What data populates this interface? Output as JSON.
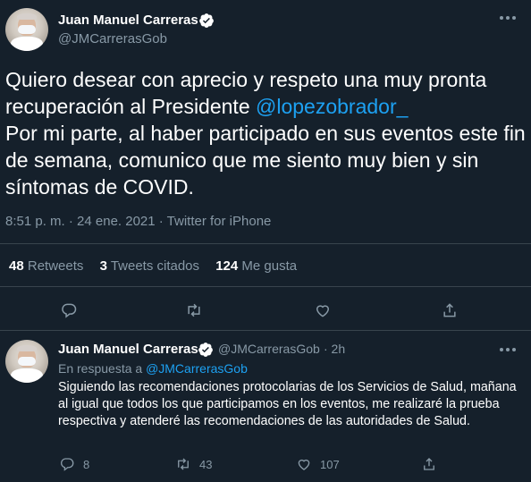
{
  "tweet": {
    "author_name": "Juan Manuel Carreras",
    "author_handle": "@JMCarrerasGob",
    "text_part1": "Quiero desear con aprecio y respeto una muy pronta recuperación al Presidente ",
    "mention": "@lopezobrador_",
    "text_part2": "Por mi parte, al haber participado en sus eventos este fin de semana, comunico que me siento muy bien y sin síntomas de COVID.",
    "meta": "8:51 p. m. · 24 ene. 2021 · Twitter for iPhone",
    "retweets_count": "48",
    "retweets_label": "Retweets",
    "quotes_count": "3",
    "quotes_label": "Tweets citados",
    "likes_count": "124",
    "likes_label": "Me gusta"
  },
  "reply": {
    "author_name": "Juan Manuel Carreras",
    "author_handle": "@JMCarrerasGob",
    "time": "· 2h",
    "in_reply_prefix": "En respuesta a ",
    "in_reply_handle": "@JMCarrerasGob",
    "text": "Siguiendo las recomendaciones protocolarias de los Servicios de Salud, mañana al igual que todos los que  participamos en los eventos, me realizaré la prueba respectiva y atenderé las recomendaciones de las autoridades de Salud.",
    "reply_count": "8",
    "retweet_count": "43",
    "like_count": "107"
  },
  "icons": {
    "verified": "verified-badge-icon",
    "more": "more-icon",
    "reply": "reply-icon",
    "retweet": "retweet-icon",
    "like": "heart-icon",
    "share": "share-icon"
  },
  "colors": {
    "background": "#15202b",
    "accent": "#1da1f2",
    "secondary_text": "#8899a6",
    "divider": "#38444d"
  }
}
